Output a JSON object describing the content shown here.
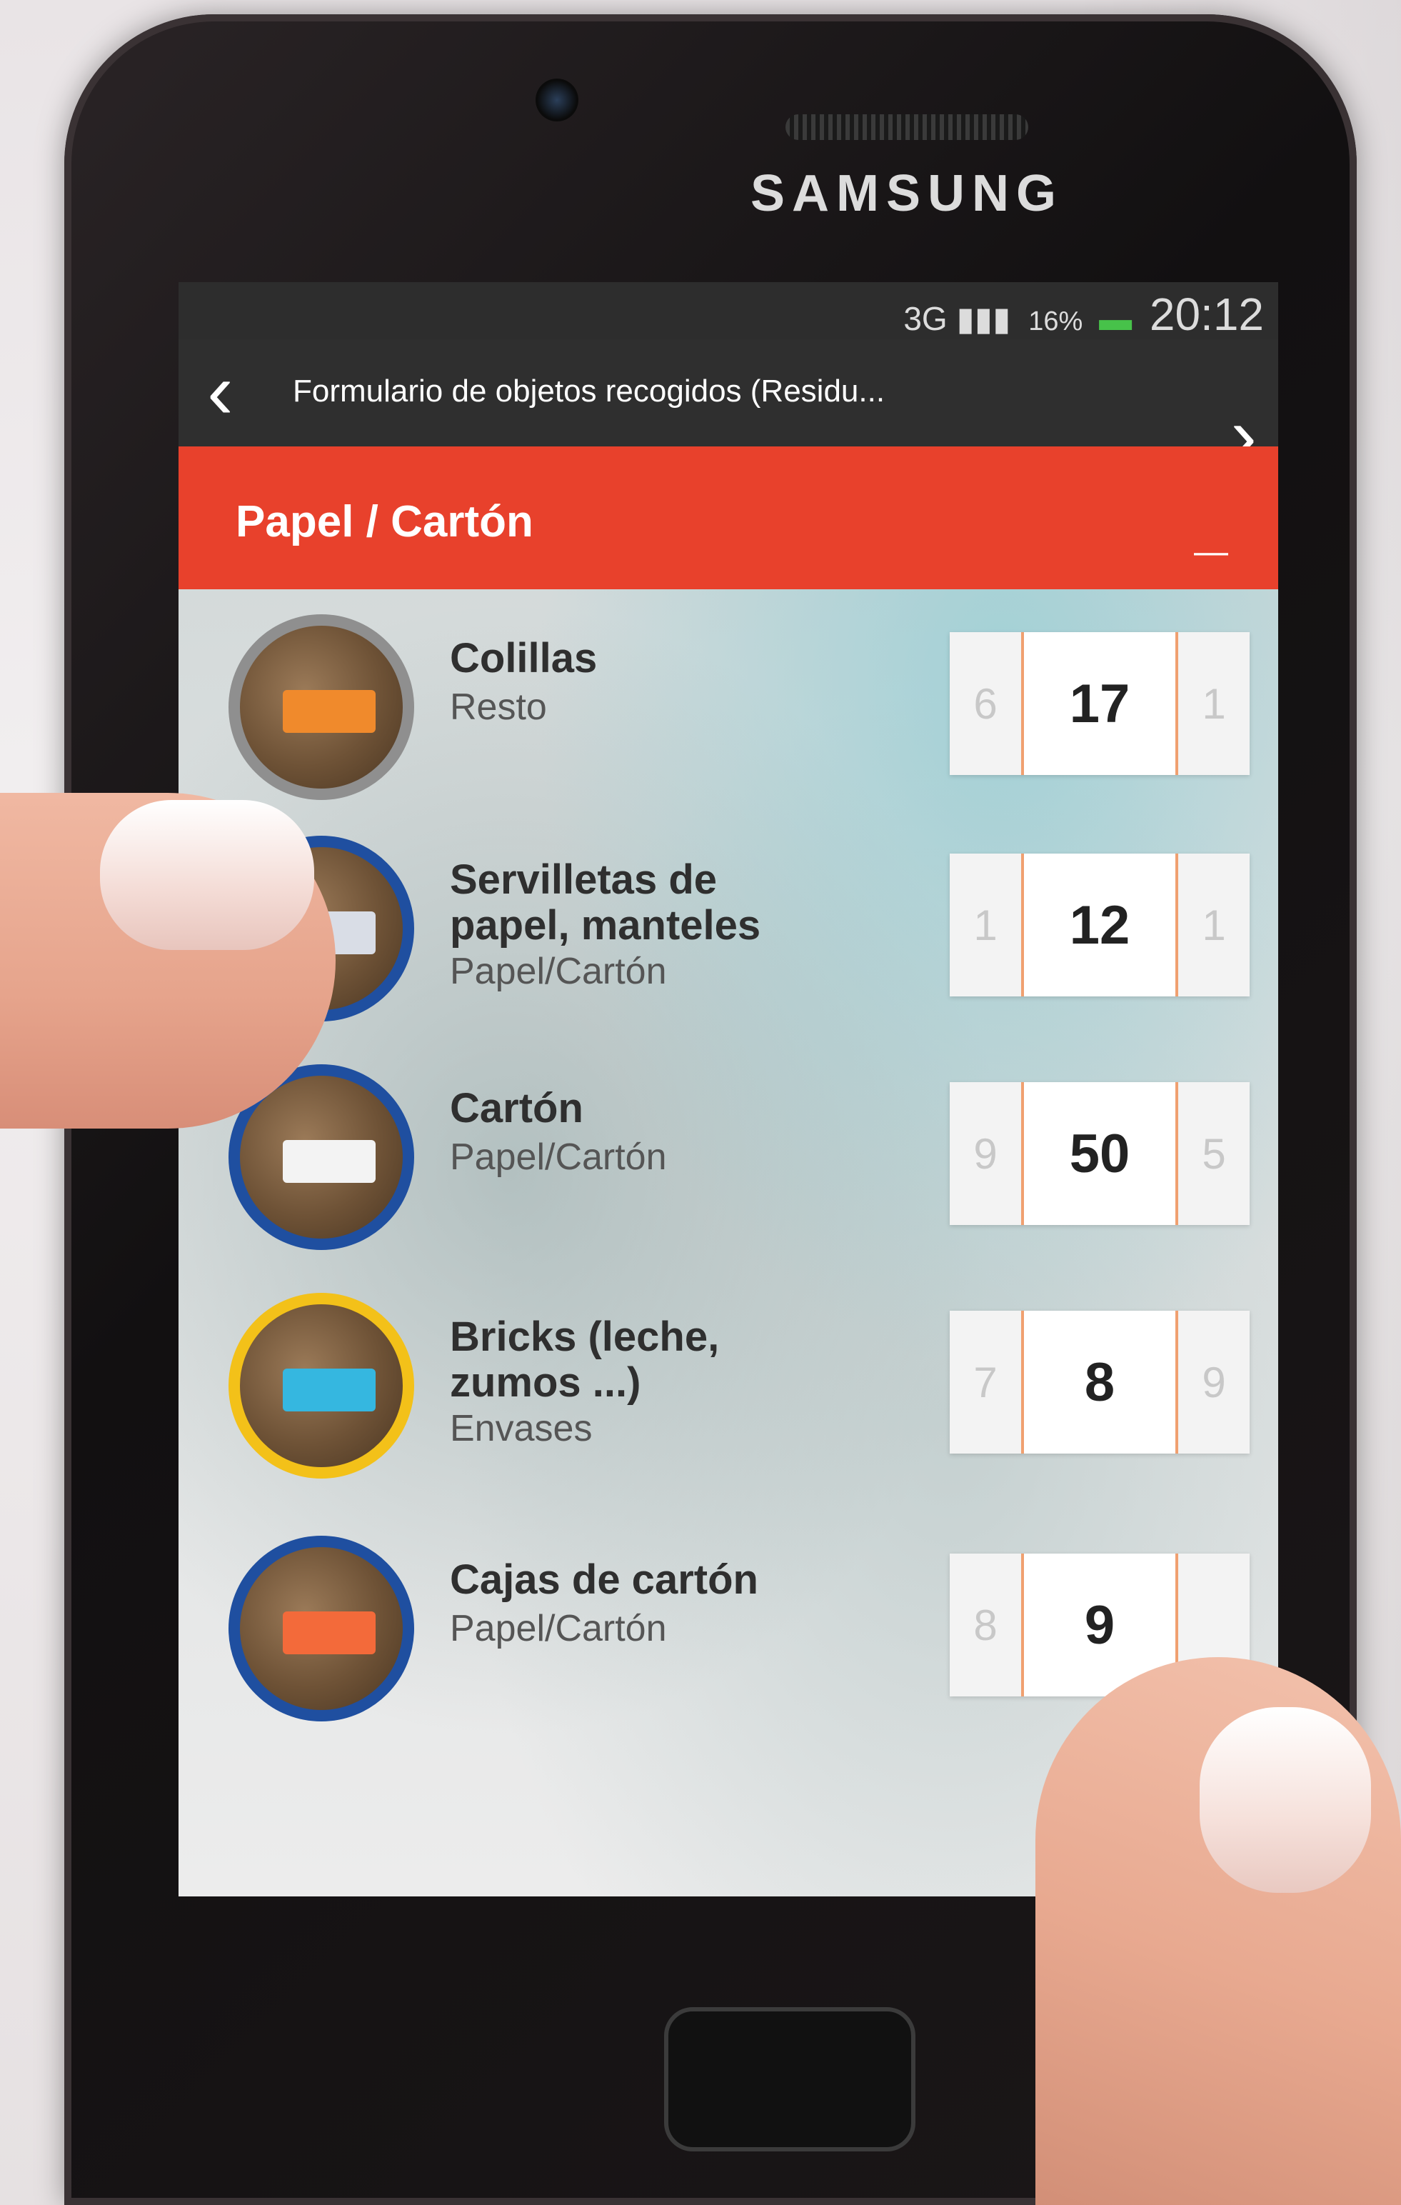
{
  "device": {
    "brand": "SAMSUNG"
  },
  "status_bar": {
    "network": "3G",
    "battery": "16%",
    "time": "20:12"
  },
  "header": {
    "title": "Formulario de objetos recogidos (Residu...",
    "back_icon": "chevron-left-icon",
    "next_icon": "chevron-right-icon"
  },
  "section": {
    "title": "Papel / Cartón",
    "collapse_label": "—"
  },
  "items": [
    {
      "name": "Colillas",
      "category": "Resto",
      "prev": "6",
      "value": "17",
      "next": "1",
      "border": "#8f8f8f"
    },
    {
      "name": "Servilletas de papel, manteles",
      "category": "Papel/Cartón",
      "prev": "1",
      "value": "12",
      "next": "1",
      "border": "#1f4fa0"
    },
    {
      "name": "Cartón",
      "category": "Papel/Cartón",
      "prev": "9",
      "value": "50",
      "next": "5",
      "border": "#1f4fa0"
    },
    {
      "name": "Bricks (leche, zumos ...)",
      "category": "Envases",
      "prev": "7",
      "value": "8",
      "next": "9",
      "border": "#f3c119"
    },
    {
      "name": "Cajas de cartón",
      "category": "Papel/Cartón",
      "prev": "8",
      "value": "9",
      "next": "",
      "border": "#1f4fa0"
    }
  ],
  "colors": {
    "accent": "#e8412c",
    "navbar": "#2f2f2f",
    "stepper_line": "#f0a070"
  }
}
